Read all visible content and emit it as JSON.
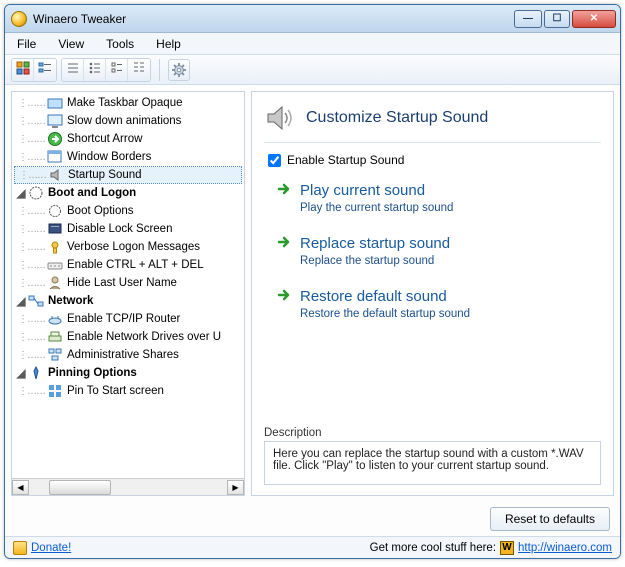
{
  "window": {
    "title": "Winaero Tweaker"
  },
  "menu": {
    "file": "File",
    "view": "View",
    "tools": "Tools",
    "help": "Help"
  },
  "tree": {
    "items": [
      {
        "label": "Make Taskbar Opaque",
        "indent": 3
      },
      {
        "label": "Slow down animations",
        "indent": 3
      },
      {
        "label": "Shortcut Arrow",
        "indent": 3
      },
      {
        "label": "Window Borders",
        "indent": 3
      },
      {
        "label": "Startup Sound",
        "indent": 3,
        "selected": true
      }
    ],
    "cats": [
      {
        "label": "Boot and Logon",
        "children": [
          {
            "label": "Boot Options"
          },
          {
            "label": "Disable Lock Screen"
          },
          {
            "label": "Verbose Logon Messages"
          },
          {
            "label": "Enable CTRL + ALT + DEL"
          },
          {
            "label": "Hide Last User Name"
          }
        ]
      },
      {
        "label": "Network",
        "children": [
          {
            "label": "Enable TCP/IP Router"
          },
          {
            "label": "Enable Network Drives over U"
          },
          {
            "label": "Administrative Shares"
          }
        ]
      },
      {
        "label": "Pinning Options",
        "children": [
          {
            "label": "Pin To Start screen"
          }
        ]
      }
    ]
  },
  "panel": {
    "title": "Customize Startup Sound",
    "enable_label": "Enable Startup Sound",
    "enable_checked": true,
    "actions": [
      {
        "title": "Play current sound",
        "desc": "Play the current startup sound"
      },
      {
        "title": "Replace startup sound",
        "desc": "Replace the startup sound"
      },
      {
        "title": "Restore default sound",
        "desc": "Restore the default startup sound"
      }
    ],
    "desc_label": "Description",
    "desc_text": "Here you can replace the startup sound with a custom *.WAV file. Click \"Play\" to listen to your current startup sound."
  },
  "footer": {
    "reset": "Reset to defaults",
    "donate": "Donate!",
    "more_text": "Get more cool stuff here:",
    "link": "http://winaero.com"
  }
}
